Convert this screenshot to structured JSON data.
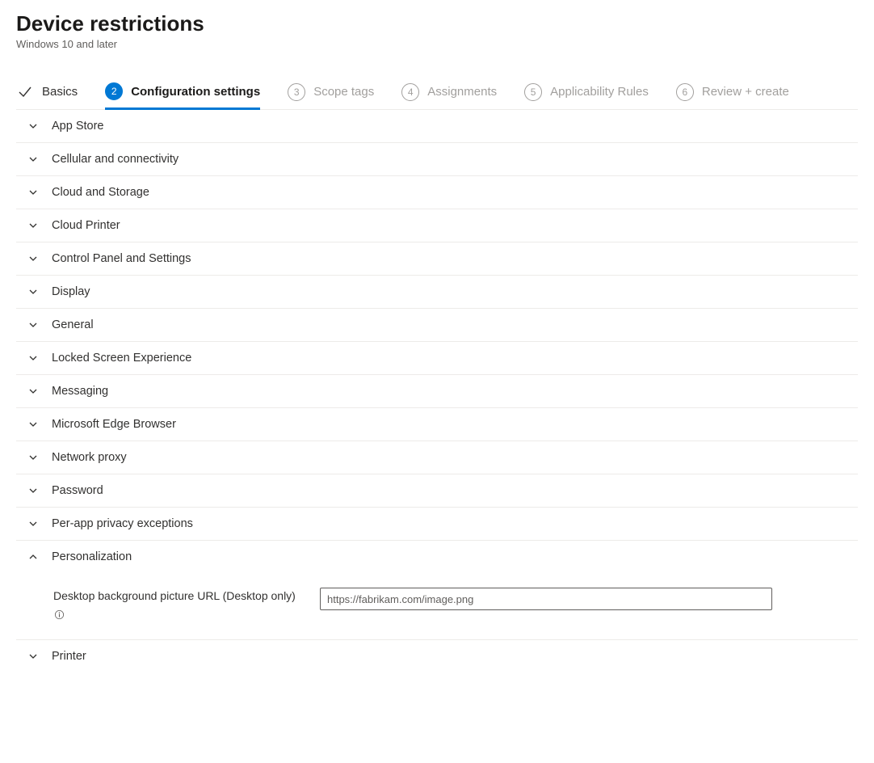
{
  "header": {
    "title": "Device restrictions",
    "subtitle": "Windows 10 and later"
  },
  "wizard": {
    "steps": [
      {
        "num": "1",
        "label": "Basics",
        "state": "done"
      },
      {
        "num": "2",
        "label": "Configuration settings",
        "state": "current"
      },
      {
        "num": "3",
        "label": "Scope tags",
        "state": "pending"
      },
      {
        "num": "4",
        "label": "Assignments",
        "state": "pending"
      },
      {
        "num": "5",
        "label": "Applicability Rules",
        "state": "pending"
      },
      {
        "num": "6",
        "label": "Review + create",
        "state": "pending"
      }
    ]
  },
  "sections": [
    {
      "label": "App Store",
      "expanded": false
    },
    {
      "label": "Cellular and connectivity",
      "expanded": false
    },
    {
      "label": "Cloud and Storage",
      "expanded": false
    },
    {
      "label": "Cloud Printer",
      "expanded": false
    },
    {
      "label": "Control Panel and Settings",
      "expanded": false
    },
    {
      "label": "Display",
      "expanded": false
    },
    {
      "label": "General",
      "expanded": false
    },
    {
      "label": "Locked Screen Experience",
      "expanded": false
    },
    {
      "label": "Messaging",
      "expanded": false
    },
    {
      "label": "Microsoft Edge Browser",
      "expanded": false
    },
    {
      "label": "Network proxy",
      "expanded": false
    },
    {
      "label": "Password",
      "expanded": false
    },
    {
      "label": "Per-app privacy exceptions",
      "expanded": false
    },
    {
      "label": "Personalization",
      "expanded": true
    },
    {
      "label": "Printer",
      "expanded": false
    }
  ],
  "personalization": {
    "field_label": "Desktop background picture URL (Desktop only)",
    "placeholder": "https://fabrikam.com/image.png",
    "value": ""
  }
}
